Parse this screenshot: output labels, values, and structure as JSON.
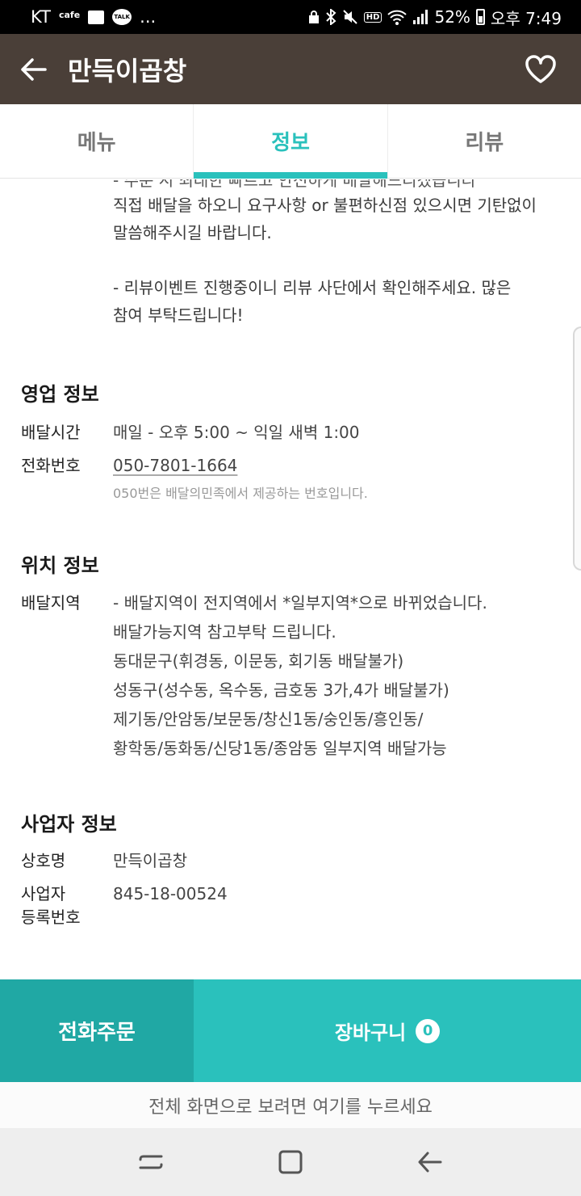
{
  "status_bar": {
    "carrier": "KT",
    "carrier_badge": "cafe",
    "talk_badge": "TALK",
    "more": "...",
    "hd": "HD",
    "battery_text": "52%",
    "time": "오후 7:49"
  },
  "header": {
    "title": "만득이곱창"
  },
  "tabs": [
    {
      "label": "메뉴"
    },
    {
      "label": "정보"
    },
    {
      "label": "리뷰"
    }
  ],
  "notice": {
    "cut_line": "- 주문 시 최대한 빠르고 안전하게 배달해드리겠습니다",
    "line1": "직접 배달을 하오니 요구사항 or 불편하신점 있으시면 기탄없이",
    "line2": "말씀해주시길 바랍니다.",
    "line3": "- 리뷰이벤트 진행중이니 리뷰 사단에서 확인해주세요. 많은",
    "line4": "참여 부탁드립니다!"
  },
  "business_hours": {
    "title": "영업 정보",
    "hours_label": "배달시간",
    "hours_value": "매일 - 오후 5:00 ~ 익일 새벽 1:00",
    "phone_label": "전화번호",
    "phone_value": "050-7801-1664",
    "phone_note": "050번은 배달의민족에서 제공하는 번호입니다."
  },
  "location": {
    "title": "위치 정보",
    "area_label": "배달지역",
    "area_lines": [
      "- 배달지역이 전지역에서 *일부지역*으로 바뀌었습니다.",
      "배달가능지역 참고부탁 드립니다.",
      "동대문구(휘경동, 이문동, 회기동 배달불가)",
      "성동구(성수동, 옥수동, 금호동 3가,4가 배달불가)",
      "제기동/안암동/보문동/창신1동/숭인동/흥인동/",
      "황학동/동화동/신당1동/종암동 일부지역 배달가능"
    ]
  },
  "business_info": {
    "title": "사업자 정보",
    "name_label": "상호명",
    "name_value": "만득이곱창",
    "reg_label_1": "사업자",
    "reg_label_2": "등록번호",
    "reg_value": "845-18-00524"
  },
  "actions": {
    "call_order": "전화주문",
    "cart": "장바구니",
    "cart_count": "0"
  },
  "fullscreen_hint": "전체 화면으로 보려면 여기를 누르세요"
}
